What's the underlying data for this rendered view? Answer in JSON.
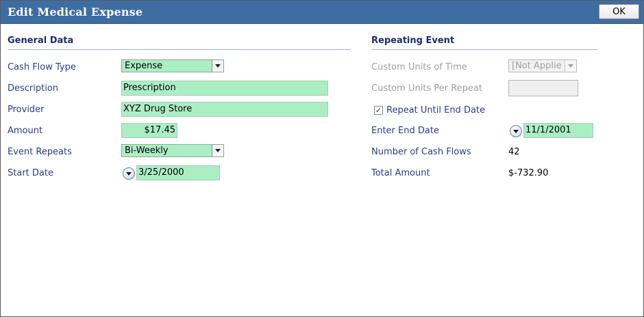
{
  "window": {
    "title": "Edit Medical Expense",
    "ok_label": "OK"
  },
  "general": {
    "heading": "General Data",
    "cash_flow_type": {
      "label": "Cash Flow Type",
      "value": "Expense"
    },
    "description": {
      "label": "Description",
      "value": "Prescription"
    },
    "provider": {
      "label": "Provider",
      "value": "XYZ Drug Store"
    },
    "amount": {
      "label": "Amount",
      "value": "$17.45"
    },
    "event_repeats": {
      "label": "Event Repeats",
      "value": "Bi-Weekly"
    },
    "start_date": {
      "label": "Start Date",
      "value": "3/25/2000"
    }
  },
  "repeating": {
    "heading": "Repeating Event",
    "custom_units_time": {
      "label": "Custom Units of Time",
      "value": "[Not Applie"
    },
    "custom_units_per_repeat": {
      "label": "Custom Units Per Repeat",
      "value": ""
    },
    "repeat_until_end": {
      "label": "Repeat Until End Date",
      "checked": true
    },
    "end_date": {
      "label": "Enter End Date",
      "value": "11/1/2001"
    },
    "num_cash_flows": {
      "label": "Number of Cash Flows",
      "value": "42"
    },
    "total_amount": {
      "label": "Total Amount",
      "value": "$-732.90"
    }
  },
  "icons": {
    "dropdown": "chevron-down-icon",
    "date_picker": "calendar-dropdown-icon",
    "checkbox_mark": "checkmark-icon"
  },
  "colors": {
    "titlebar": "#3e6da2",
    "field_fill": "#aceec4",
    "label_text": "#2a3b8a",
    "section_heading": "#1d2c6b",
    "disabled_text": "#a0a0a0"
  }
}
